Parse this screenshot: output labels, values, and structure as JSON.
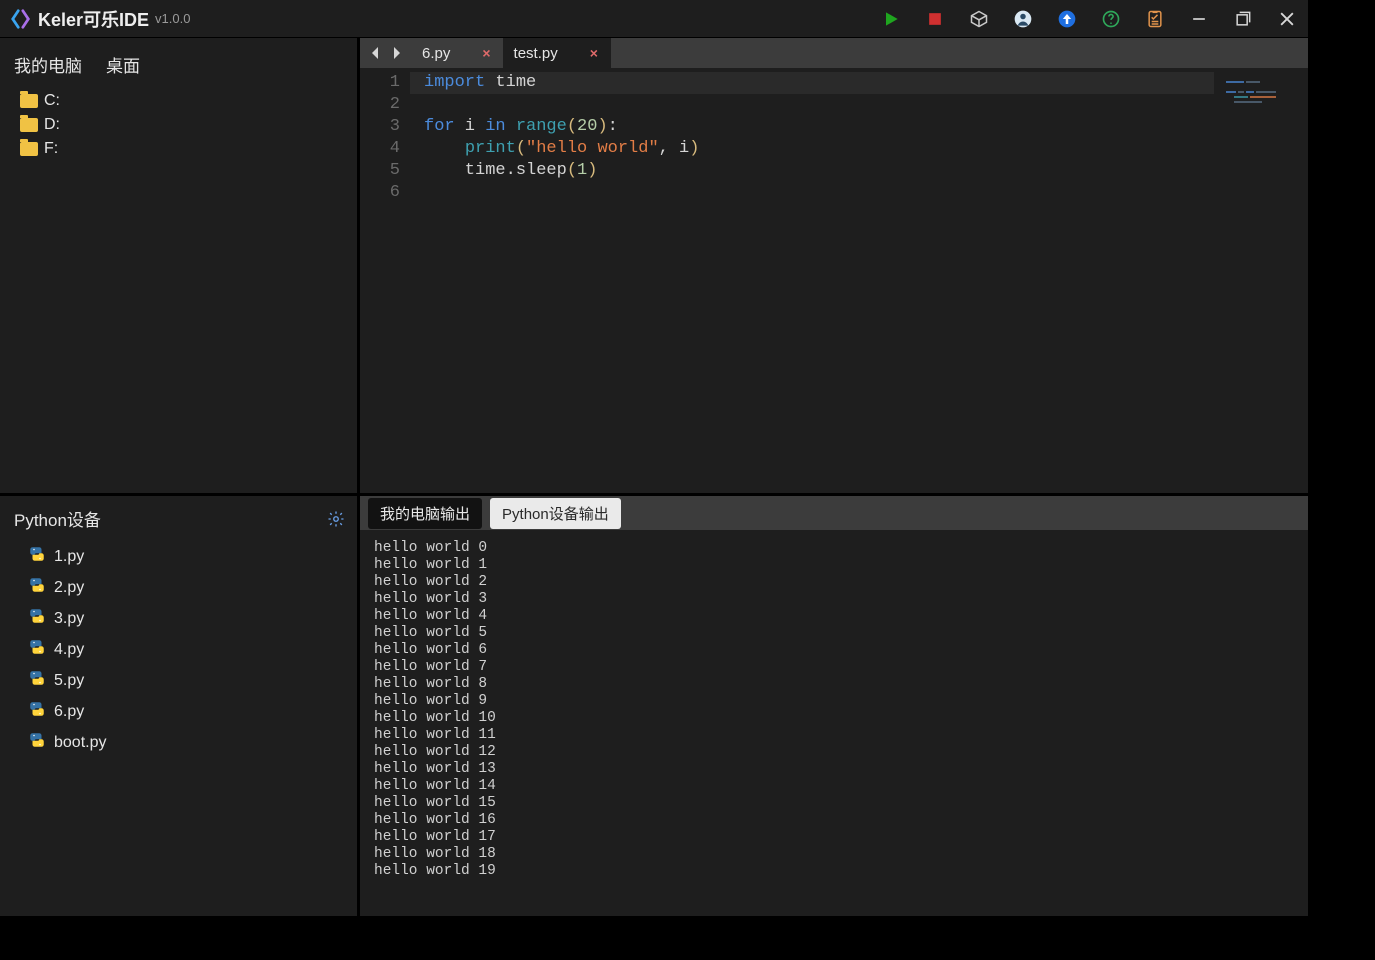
{
  "titlebar": {
    "app_name": "Keler可乐IDE",
    "version": "v1.0.0",
    "icons": {
      "run": "run-icon",
      "stop": "stop-icon",
      "package": "package-icon",
      "account": "account-icon",
      "upload": "upload-icon",
      "help": "help-icon",
      "tasks": "tasks-icon",
      "minimize": "minimize-icon",
      "maximize": "maximize-icon",
      "close": "close-icon"
    }
  },
  "explorer": {
    "tabs": [
      "我的电脑",
      "桌面"
    ],
    "drives": [
      "C:",
      "D:",
      "F:"
    ]
  },
  "editor": {
    "nav": {
      "prev": "◀",
      "next": "▶"
    },
    "tabs": [
      {
        "name": "6.py",
        "active": false
      },
      {
        "name": "test.py",
        "active": true
      }
    ],
    "lines": [
      {
        "n": 1,
        "tokens": [
          [
            "kw",
            "import"
          ],
          [
            "id",
            " time"
          ]
        ]
      },
      {
        "n": 2,
        "tokens": []
      },
      {
        "n": 3,
        "tokens": [
          [
            "kw",
            "for"
          ],
          [
            "id",
            " i "
          ],
          [
            "kw",
            "in"
          ],
          [
            "id",
            " "
          ],
          [
            "fn",
            "range"
          ],
          [
            "op",
            "("
          ],
          [
            "num",
            "20"
          ],
          [
            "op",
            ")"
          ],
          [
            "id",
            ":"
          ]
        ]
      },
      {
        "n": 4,
        "tokens": [
          [
            "id",
            "    "
          ],
          [
            "fn",
            "print"
          ],
          [
            "op",
            "("
          ],
          [
            "str",
            "\"hello world\""
          ],
          [
            "id",
            ", i"
          ],
          [
            "op",
            ")"
          ]
        ]
      },
      {
        "n": 5,
        "tokens": [
          [
            "id",
            "    time.sleep"
          ],
          [
            "op",
            "("
          ],
          [
            "num",
            "1"
          ],
          [
            "op",
            ")"
          ]
        ]
      },
      {
        "n": 6,
        "tokens": []
      }
    ],
    "highlighted_line": 1
  },
  "device_panel": {
    "title": "Python设备",
    "files": [
      "1.py",
      "2.py",
      "3.py",
      "4.py",
      "5.py",
      "6.py",
      "boot.py"
    ]
  },
  "output_panel": {
    "tabs": [
      {
        "label": "我的电脑输出",
        "style": "dark"
      },
      {
        "label": "Python设备输出",
        "style": "light"
      }
    ],
    "lines": [
      "hello world 0",
      "hello world 1",
      "hello world 2",
      "hello world 3",
      "hello world 4",
      "hello world 5",
      "hello world 6",
      "hello world 7",
      "hello world 8",
      "hello world 9",
      "hello world 10",
      "hello world 11",
      "hello world 12",
      "hello world 13",
      "hello world 14",
      "hello world 15",
      "hello world 16",
      "hello world 17",
      "hello world 18",
      "hello world 19"
    ]
  }
}
